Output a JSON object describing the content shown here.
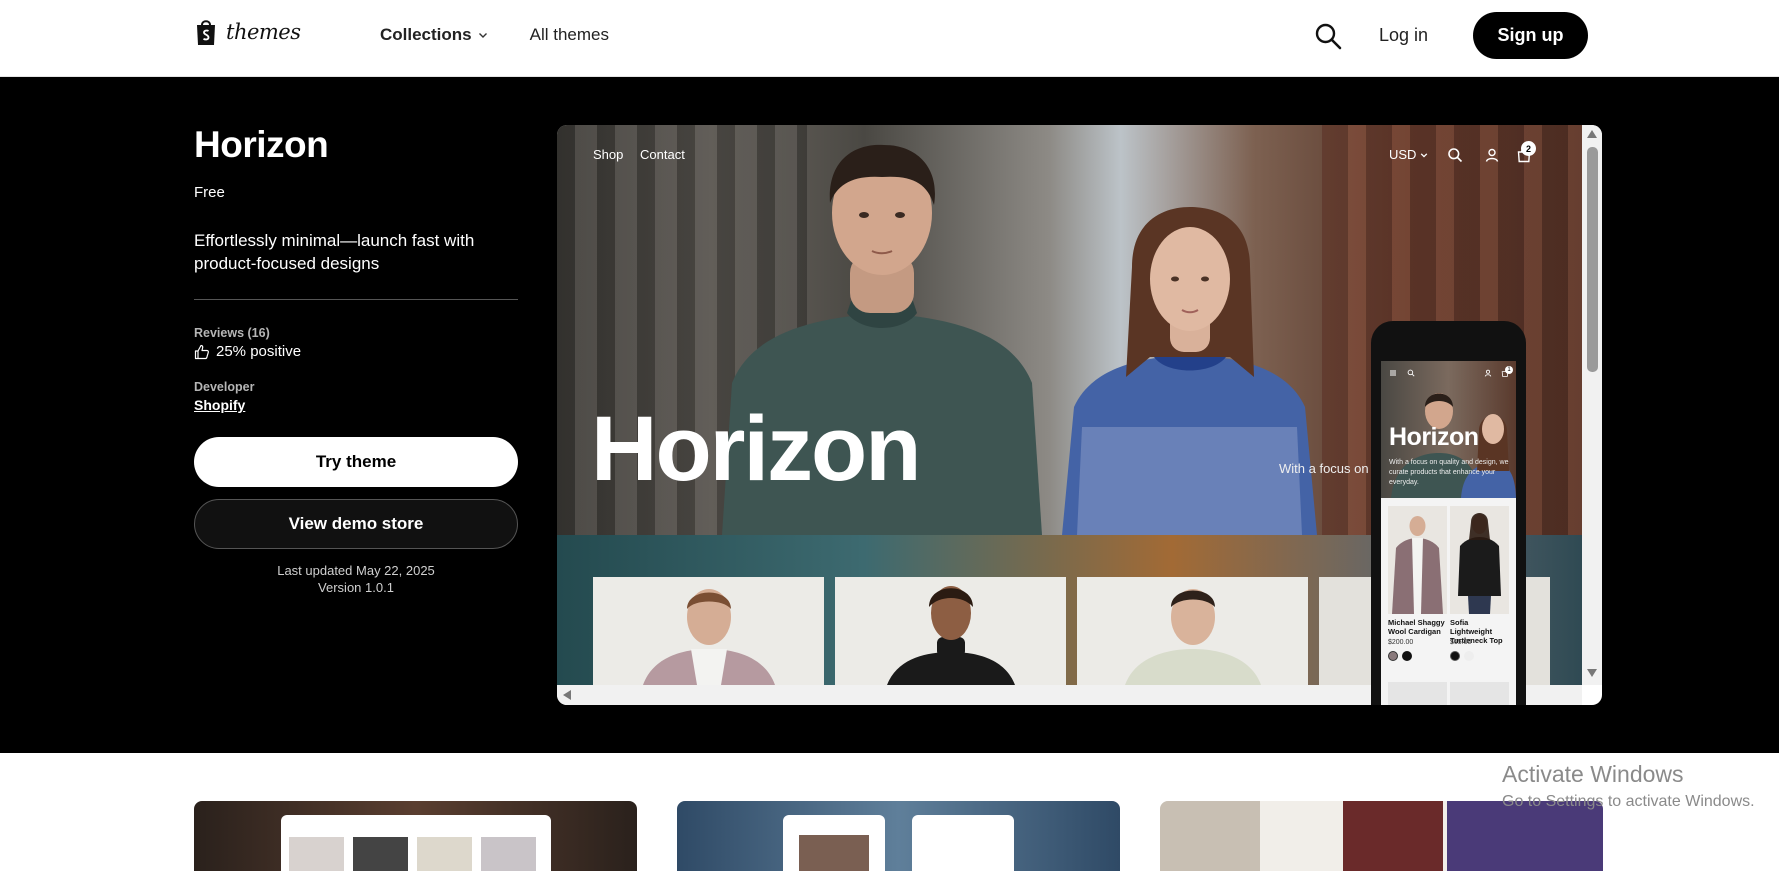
{
  "header": {
    "logo_text": "themes",
    "nav": {
      "collections": "Collections",
      "all_themes": "All themes"
    },
    "login": "Log in",
    "signup": "Sign up"
  },
  "theme": {
    "title": "Horizon",
    "price": "Free",
    "tagline": "Effortlessly minimal—launch fast with product-focused designs",
    "reviews_label": "Reviews (16)",
    "reviews_value": "25% positive",
    "developer_label": "Developer",
    "developer_name": "Shopify",
    "try_button": "Try theme",
    "demo_button": "View demo store",
    "last_updated": "Last updated May 22, 2025",
    "version": "Version 1.0.1"
  },
  "preview": {
    "nav_shop": "Shop",
    "nav_contact": "Contact",
    "currency": "USD",
    "cart_count": "2",
    "hero_title": "Horizon",
    "hero_sub": "With a focus on quality and design, we curate products that enhance your everyday."
  },
  "phone": {
    "cart_count": "1",
    "hero_title": "Horizon",
    "hero_sub": "With a focus on quality and design, we curate products that enhance your everyday.",
    "products": [
      {
        "name": "Michael Shaggy Wool Cardigan",
        "price": "$200.00"
      },
      {
        "name": "Sofia Lightweight Turtleneck Top",
        "price": "$65.00"
      }
    ]
  },
  "watermark": {
    "line1": "Activate Windows",
    "line2": "Go to Settings to activate Windows."
  },
  "colors": {
    "hero_bg": "#000000",
    "signup_bg": "#000000",
    "accent_white": "#ffffff"
  }
}
